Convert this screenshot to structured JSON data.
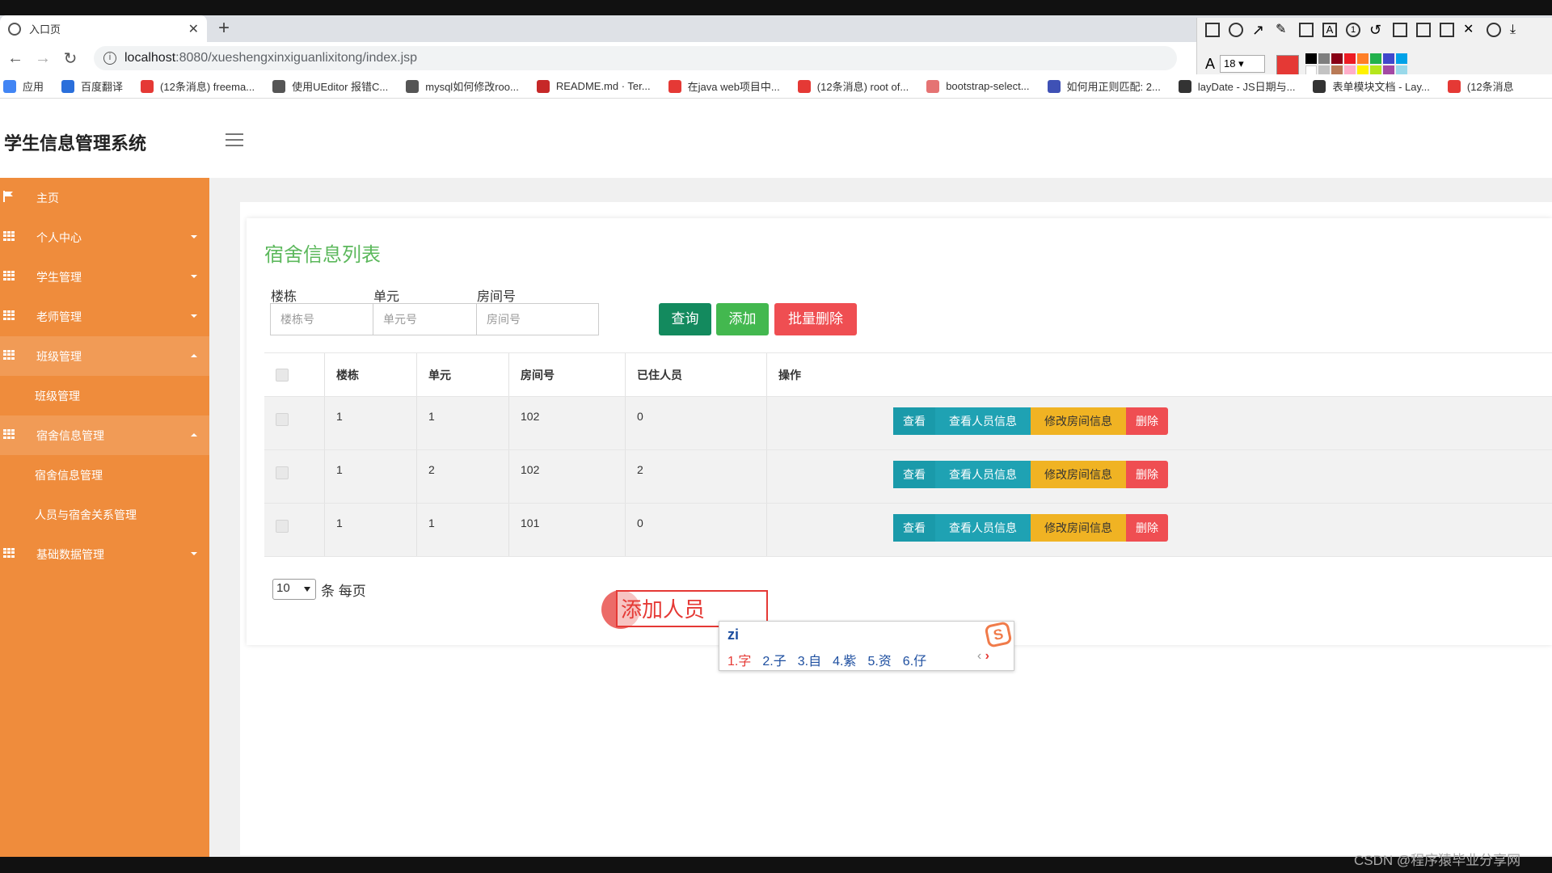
{
  "browser": {
    "tab_title": "入口页",
    "url_host": "localhost",
    "url_rest": ":8080/xueshengxinxiguanlixitong/index.jsp",
    "bookmarks": [
      {
        "label": "应用",
        "color": "#4285f4"
      },
      {
        "label": "百度翻译",
        "color": "#2a6fdb"
      },
      {
        "label": "(12条消息) freema...",
        "color": "#e53935"
      },
      {
        "label": "使用UEditor 报错C...",
        "color": "#555555"
      },
      {
        "label": "mysql如何修改roo...",
        "color": "#555555"
      },
      {
        "label": "README.md · Ter...",
        "color": "#c62828"
      },
      {
        "label": "在java web项目中...",
        "color": "#e53935"
      },
      {
        "label": "(12条消息) root of...",
        "color": "#e53935"
      },
      {
        "label": "bootstrap-select...",
        "color": "#e57373"
      },
      {
        "label": "如何用正则匹配: 2...",
        "color": "#3f51b5"
      },
      {
        "label": "layDate - JS日期与...",
        "color": "#333333"
      },
      {
        "label": "表单模块文档 - Lay...",
        "color": "#333333"
      },
      {
        "label": "(12条消息",
        "color": "#e53935"
      }
    ],
    "annot_font_size": "18"
  },
  "app": {
    "title": "学生信息管理系统",
    "sidebar": [
      {
        "label": "主页",
        "icon": "flag-icon",
        "caret": "none",
        "open": false
      },
      {
        "label": "个人中心",
        "icon": "grid-icon",
        "caret": "down",
        "open": false
      },
      {
        "label": "学生管理",
        "icon": "grid-icon",
        "caret": "down",
        "open": false
      },
      {
        "label": "老师管理",
        "icon": "grid-icon",
        "caret": "down",
        "open": false
      },
      {
        "label": "班级管理",
        "icon": "grid-icon",
        "caret": "up",
        "open": true,
        "children": [
          "班级管理"
        ]
      },
      {
        "label": "宿舍信息管理",
        "icon": "grid-icon",
        "caret": "up",
        "open": true,
        "children": [
          "宿舍信息管理",
          "人员与宿舍关系管理"
        ]
      },
      {
        "label": "基础数据管理",
        "icon": "grid-icon",
        "caret": "down",
        "open": false
      }
    ]
  },
  "panel": {
    "title": "宿舍信息列表",
    "filters": [
      {
        "label": "楼栋",
        "placeholder": "楼栋号"
      },
      {
        "label": "单元",
        "placeholder": "单元号"
      },
      {
        "label": "房间号",
        "placeholder": "房间号"
      }
    ],
    "buttons": {
      "query": "查询",
      "add": "添加",
      "batch_delete": "批量删除"
    },
    "columns": [
      "楼栋",
      "单元",
      "房间号",
      "已住人员",
      "操作"
    ],
    "rows": [
      [
        "1",
        "1",
        "102",
        "0"
      ],
      [
        "1",
        "2",
        "102",
        "2"
      ],
      [
        "1",
        "1",
        "101",
        "0"
      ]
    ],
    "row_actions": {
      "view": "查看",
      "view_people": "查看人员信息",
      "edit_room": "修改房间信息",
      "delete": "删除"
    },
    "page_size": "10",
    "page_size_suffix": "条 每页"
  },
  "overlay": {
    "annotation_text": "添加人员",
    "ime_composition": "zi",
    "ime_candidates": [
      "1.字",
      "2.子",
      "3.自",
      "4.紫",
      "5.资",
      "6.仔"
    ]
  },
  "watermark": "CSDN @程序猿毕业分享网"
}
